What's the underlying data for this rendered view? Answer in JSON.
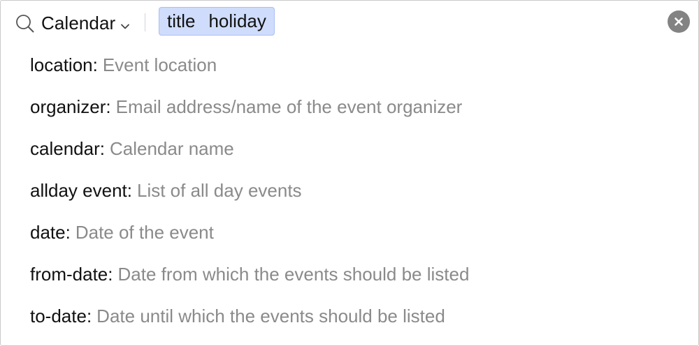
{
  "search": {
    "scope_label": "Calendar",
    "chip": {
      "term_1": "title",
      "term_2": "holiday"
    }
  },
  "suggestions": [
    {
      "key": "location:",
      "description": "Event location"
    },
    {
      "key": "organizer:",
      "description": "Email address/name of the event organizer"
    },
    {
      "key": "calendar:",
      "description": "Calendar name"
    },
    {
      "key": "allday event:",
      "description": "List of all day events"
    },
    {
      "key": "date:",
      "description": "Date of the event"
    },
    {
      "key": "from-date:",
      "description": "Date from which the events should be listed"
    },
    {
      "key": "to-date:",
      "description": "Date until which the events should be listed"
    }
  ],
  "icons": {
    "search": "search-icon",
    "scope_chevron": "chevron-down-icon",
    "clear": "close-icon"
  },
  "colors": {
    "chip_background": "#cfdcfb",
    "chip_border": "#a9c0f3",
    "clear_button": "#838383",
    "description_text": "#8a8a8a"
  }
}
